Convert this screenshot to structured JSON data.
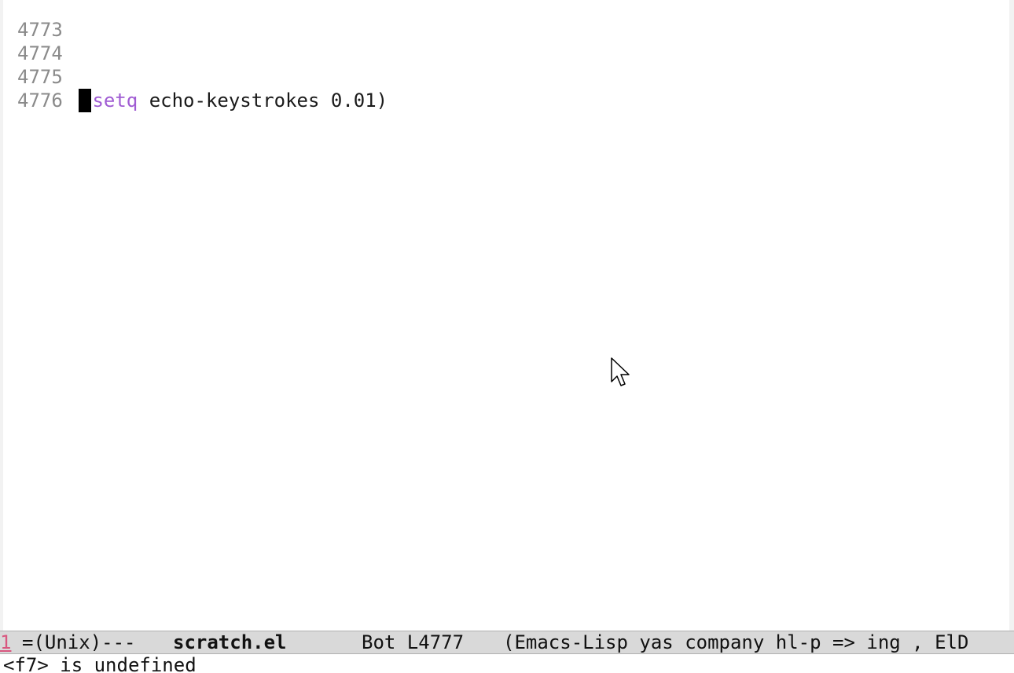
{
  "editor": {
    "lines": [
      {
        "num": "4773",
        "code": ""
      },
      {
        "num": "4774",
        "code": ""
      },
      {
        "num": "4775",
        "paren_open": "(",
        "keyword": "setq",
        "rest": " echo-keystrokes 0.01)"
      },
      {
        "num": "4776",
        "code": ""
      }
    ],
    "keyword_color": "#a05cd3"
  },
  "modeline": {
    "window_number": "1",
    "encoding": "=(Unix)---",
    "buffer_name": "scratch.el",
    "position": "Bot L4777",
    "modes": "(Emacs-Lisp yas company hl-p => ing , ElD"
  },
  "echo_area": {
    "message": "<f7> is undefined"
  },
  "icons": {
    "cursor": "text-cursor-block",
    "pointer": "mouse-pointer-icon"
  }
}
